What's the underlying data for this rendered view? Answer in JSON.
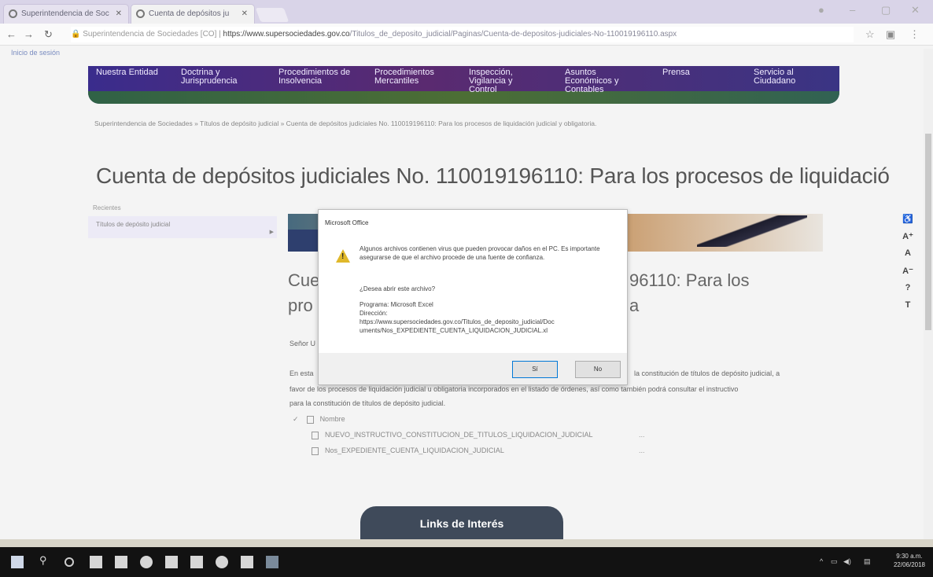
{
  "browser": {
    "tabs": [
      {
        "label": "Superintendencia de Soc"
      },
      {
        "label": "Cuenta de depósitos ju"
      }
    ],
    "address": {
      "site_name": "Superintendencia de Sociedades [CO]",
      "url_domain": "https://www.supersociedades.gov.co",
      "url_path": "/Titulos_de_deposito_judicial/Paginas/Cuenta-de-depositos-judiciales-No-110019196110.aspx"
    }
  },
  "session_link": "Inicio de sesión",
  "site_nav": [
    {
      "label_1": "Nuestra Entidad",
      "label_2": ""
    },
    {
      "label_1": "Doctrina y",
      "label_2": "Jurisprudencia"
    },
    {
      "label_1": "Procedimientos de",
      "label_2": "Insolvencia"
    },
    {
      "label_1": "Procedimientos",
      "label_2": "Mercantiles"
    },
    {
      "label_1": "Inspección,",
      "label_2": "Vigilancia y",
      "label_3": "Control"
    },
    {
      "label_1": "Asuntos",
      "label_2": "Económicos y",
      "label_3": "Contables"
    },
    {
      "label_1": "Prensa",
      "label_2": ""
    },
    {
      "label_1": "Servicio al",
      "label_2": "Ciudadano"
    }
  ],
  "breadcrumb": "Superintendencia de Sociedades » Títulos de depósito judicial » Cuenta de depósitos judiciales No. 110019196110: Para los procesos de liquidación judicial y obligatoria.",
  "page_title": "Cuenta de depósitos judiciales No. 110019196110: Para los procesos de liquidació",
  "side_menu": {
    "heading": "Recientes",
    "item": "Títulos de depósito judicial"
  },
  "content": {
    "title_left_1": "Cue",
    "title_right_1": "96110: Para los",
    "title_left_2": "pro",
    "title_right_2": "a",
    "salutation": "Señor U",
    "para_1_left": "En esta",
    "para_1_right": "la constitución de títulos de depósito judicial, a",
    "para_2": "favor de los procesos de liquidación judicial u obligatoria incorporados en el listado de órdenes, así como también podrá consultar el instructivo",
    "para_3": "para la constitución de títulos de depósito judicial.",
    "files_header": "Nombre",
    "files": [
      "NUEVO_INSTRUCTIVO_CONSTITUCION_DE_TITULOS_LIQUIDACION_JUDICIAL",
      "Nos_EXPEDIENTE_CUENTA_LIQUIDACION_JUDICIAL"
    ],
    "more": "..."
  },
  "dialog": {
    "title": "Microsoft Office",
    "message": "Algunos archivos contienen virus que pueden provocar daños en el PC. Es importante asegurarse de que el archivo procede de una fuente de confianza.",
    "question": "¿Desea abrir este archivo?",
    "program_line": "Programa: Microsoft Excel",
    "address_label": "Dirección:",
    "address_1": "https://www.supersociedades.gov.co/Titulos_de_deposito_judicial/Doc",
    "address_2": "uments/Nos_EXPEDIENTE_CUENTA_LIQUIDACION_JUDICIAL.xl",
    "yes": "Sí",
    "no": "No"
  },
  "accessibility": [
    "♿",
    "A⁺",
    "A",
    "A⁻",
    "?",
    "T"
  ],
  "links_label": "Links de Interés",
  "taskbar": {
    "time": "9:30 a.m.",
    "date": "22/06/2018"
  }
}
